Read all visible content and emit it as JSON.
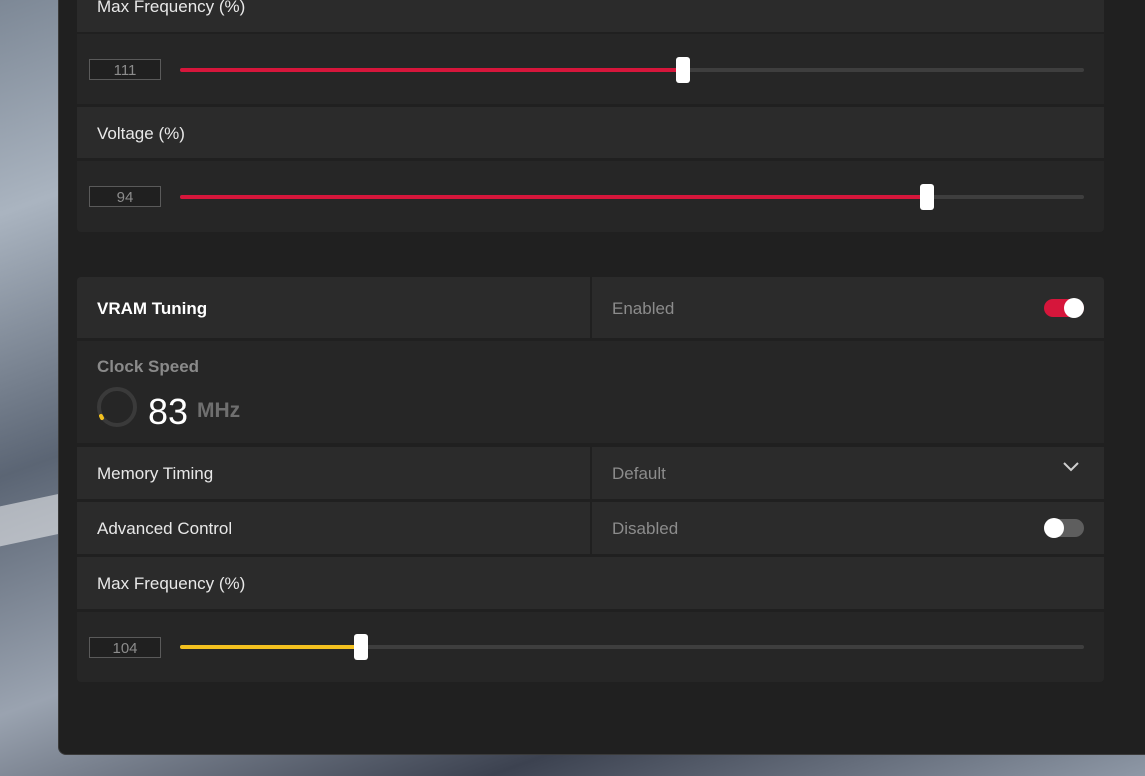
{
  "gpu_section": {
    "max_frequency": {
      "label": "Max Frequency (%)",
      "value": "111",
      "percent": 0.556
    },
    "voltage": {
      "label": "Voltage (%)",
      "value": "94",
      "percent": 0.826
    }
  },
  "vram_section": {
    "title": "VRAM Tuning",
    "status": "Enabled",
    "toggle_on": true,
    "clock": {
      "title": "Clock Speed",
      "value": "83",
      "unit": "MHz"
    },
    "memory_timing": {
      "label": "Memory Timing",
      "value": "Default"
    },
    "advanced_control": {
      "label": "Advanced Control",
      "value": "Disabled",
      "toggle_on": false
    },
    "max_frequency": {
      "label": "Max Frequency (%)",
      "value": "104",
      "percent": 0.2
    }
  },
  "colors": {
    "accent_red": "#d6163b",
    "accent_yellow": "#f3c11f"
  }
}
